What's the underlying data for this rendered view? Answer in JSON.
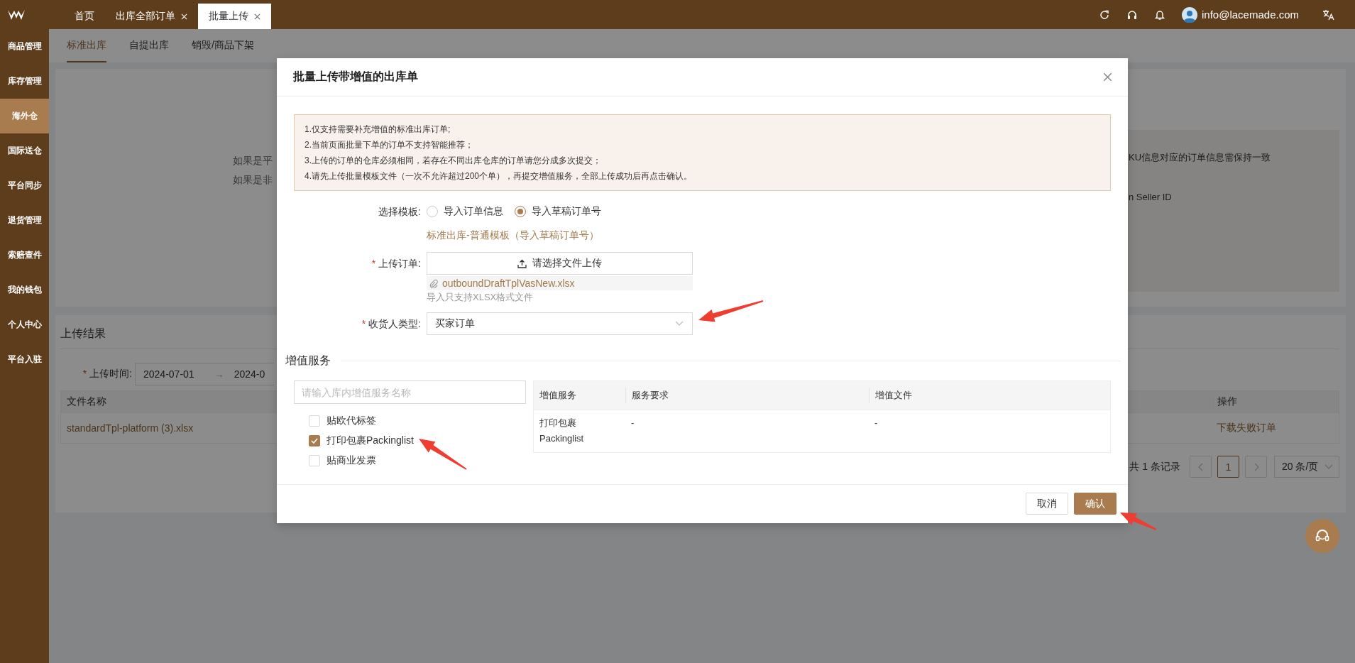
{
  "top_bar": {
    "tabs": [
      {
        "label": "首页",
        "selected": false,
        "closable": false
      },
      {
        "label": "出库全部订单",
        "selected": false,
        "closable": true
      },
      {
        "label": "批量上传",
        "selected": true,
        "closable": true
      }
    ],
    "user": "info@lacemade.com"
  },
  "sidebar": {
    "items": [
      {
        "label": "商品管理",
        "selected": false
      },
      {
        "label": "库存管理",
        "selected": false
      },
      {
        "label": "海外仓",
        "selected": true
      },
      {
        "label": "国际送仓",
        "selected": false
      },
      {
        "label": "平台同步",
        "selected": false
      },
      {
        "label": "退货管理",
        "selected": false
      },
      {
        "label": "索赔查件",
        "selected": false
      },
      {
        "label": "我的钱包",
        "selected": false
      },
      {
        "label": "个人中心",
        "selected": false
      },
      {
        "label": "平台入驻",
        "selected": false
      }
    ]
  },
  "page": {
    "tabs": [
      {
        "label": "标准出库",
        "selected": true
      },
      {
        "label": "自提出库",
        "selected": false
      },
      {
        "label": "销毁/商品下架",
        "selected": false
      }
    ],
    "notice_left": [
      "如果是平",
      "如果是非"
    ],
    "notice_right": [
      "KU信息对应的订单信息需保持一致",
      "n Seller ID"
    ],
    "results": {
      "title": "上传结果",
      "mark": "*",
      "date_label": "上传时间:",
      "date_from": "2024-07-01",
      "separator": "→",
      "date_to": "2024-0",
      "columns": [
        "文件名称",
        "操作"
      ],
      "rows": [
        {
          "file": "standardTpl-platform (3).xlsx",
          "action": "下载失败订单"
        }
      ],
      "total": "共 1 条记录",
      "pages": [
        {
          "label": "1",
          "selected": true
        }
      ],
      "page_size": "20 条/页"
    }
  },
  "dialog": {
    "title": "批量上传带增值的出库单",
    "notice": [
      "1.仅支持需要补充增值的标准出库订单;",
      "2.当前页面批量下单的订单不支持智能推荐；",
      "3.上传的订单的仓库必须相同，若存在不同出库仓库的订单请您分成多次提交；",
      "4.请先上传批量模板文件（一次不允许超过200个单），再提交增值服务，全部上传成功后再点击确认。"
    ],
    "template": {
      "label": "选择模板:",
      "options": [
        {
          "label": "导入订单信息",
          "selected": false
        },
        {
          "label": "导入草稿订单号",
          "selected": true
        }
      ],
      "link": "标准出库-普通模板（导入草稿订单号）"
    },
    "upload": {
      "mark": "*",
      "label": "上传订单:",
      "button": "请选择文件上传",
      "file": "outboundDraftTplVasNew.xlsx",
      "hint": "导入只支持XLSX格式文件"
    },
    "consignee": {
      "mark": "*",
      "label": "收货人类型:",
      "value": "买家订单"
    },
    "services": {
      "title": "增值服务",
      "search_placeholder": "请输入库内增值服务名称",
      "options": [
        {
          "label": "贴欧代标签",
          "checked": false
        },
        {
          "label": "打印包裹Packinglist",
          "checked": true
        },
        {
          "label": "贴商业发票",
          "checked": false
        }
      ],
      "table": {
        "columns": [
          "增值服务",
          "服务要求",
          "增值文件"
        ],
        "rows": [
          [
            "打印包裹Packinglist",
            "-",
            "-"
          ]
        ]
      }
    },
    "buttons": [
      {
        "label": "取消",
        "kind": "default"
      },
      {
        "label": "确认",
        "kind": "primary"
      }
    ]
  }
}
